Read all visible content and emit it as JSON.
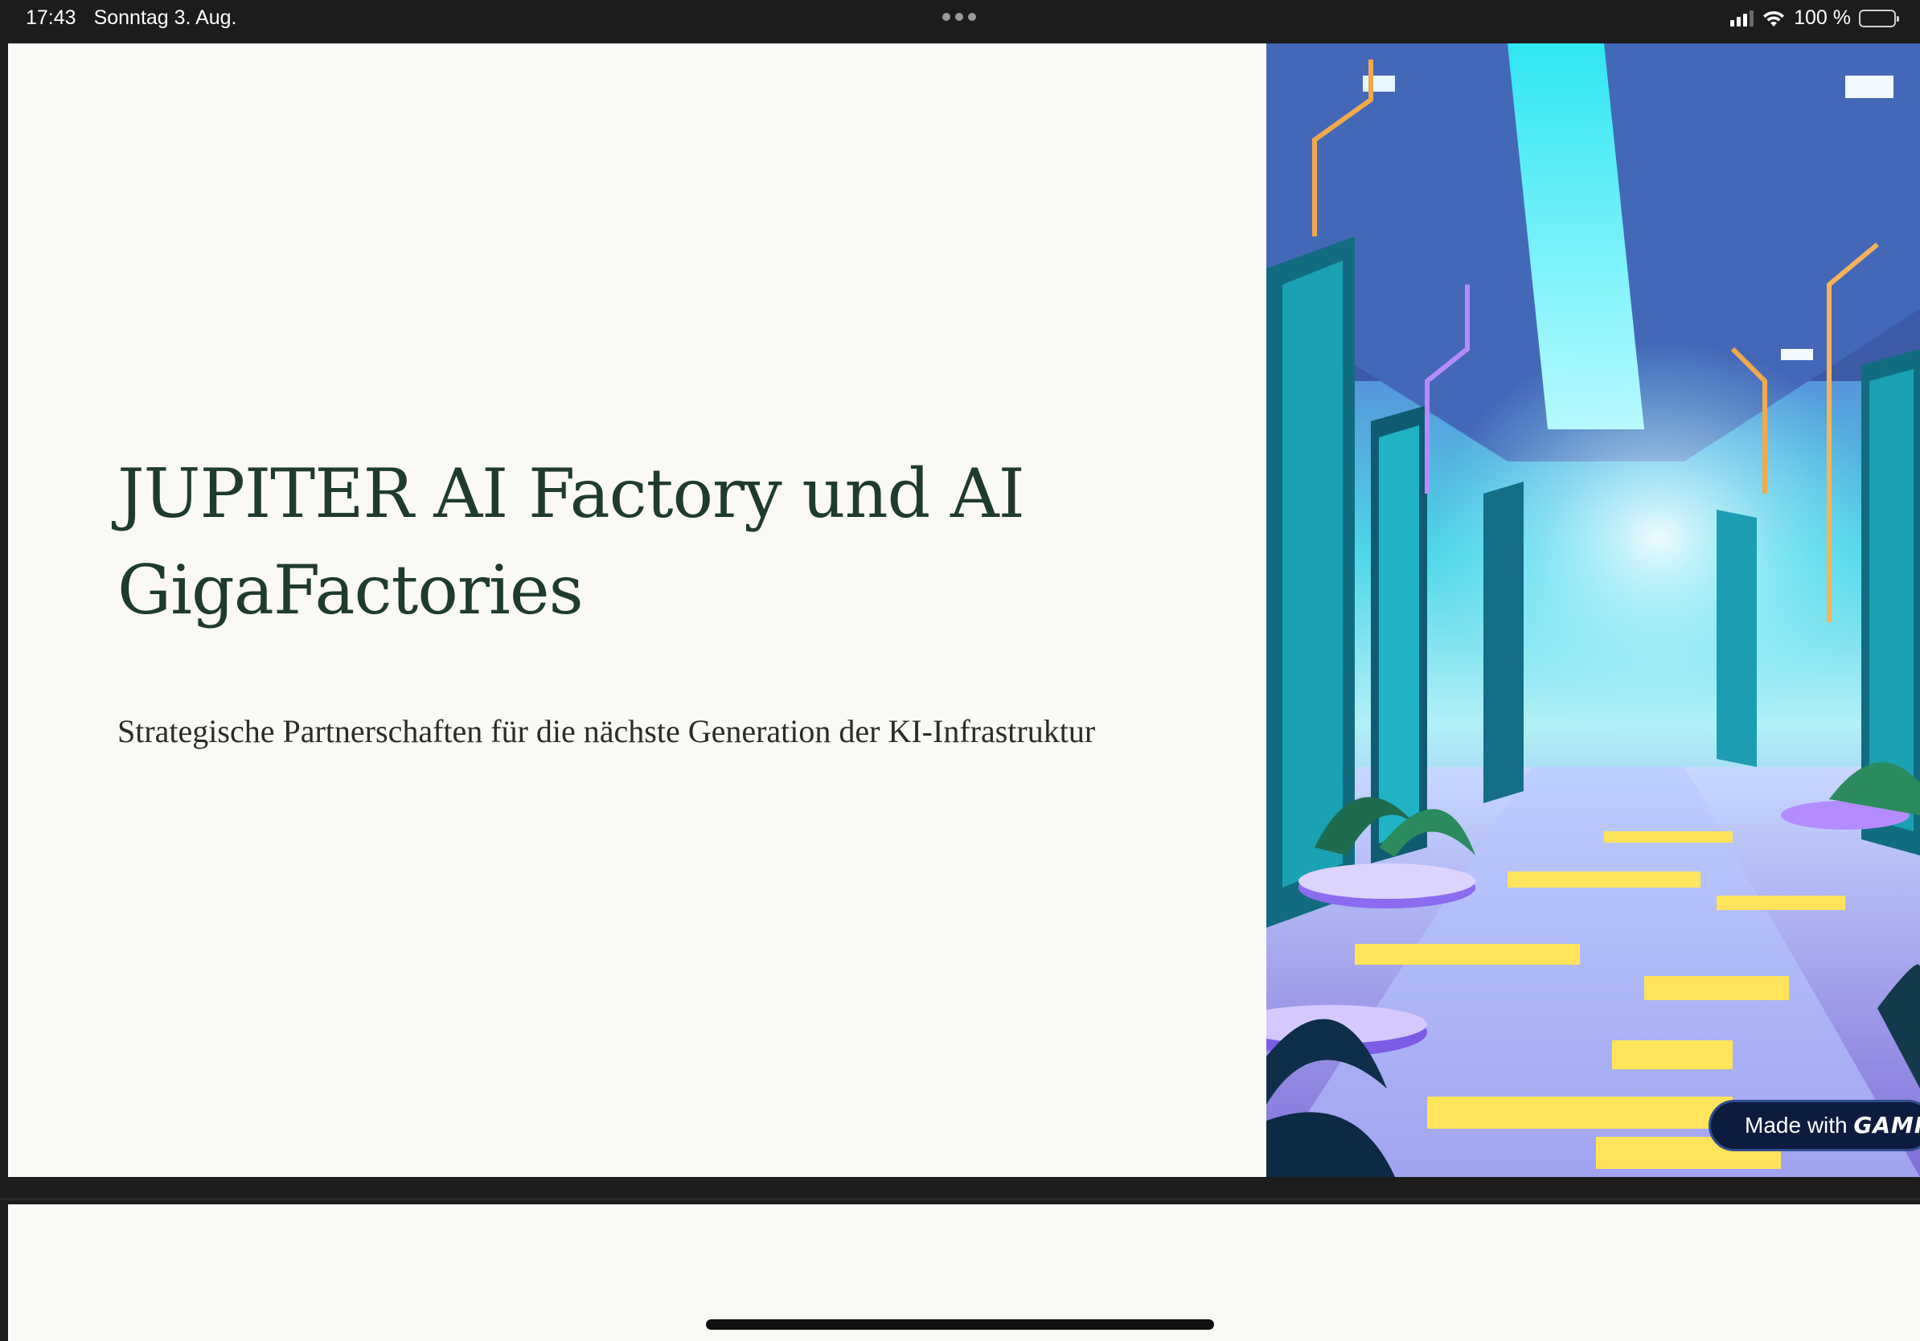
{
  "status_bar": {
    "time": "17:43",
    "date": "Sonntag 3. Aug.",
    "battery_text": "100 %",
    "signal_icon": "cellular-signal-icon",
    "wifi_icon": "wifi-icon",
    "battery_icon": "battery-icon",
    "multitask_icon": "multitasking-dots-icon"
  },
  "slide": {
    "title": "JUPITER AI Factory und AI GigaFactories",
    "subtitle": "Strategische Partnerschaften für die nächste Generation der KI-Infrastruktur",
    "title_color": "#1f3b30",
    "background": "#fbf9f5"
  },
  "badge": {
    "prefix": "Made with ",
    "brand": "GAMMA"
  },
  "colors": {
    "system_bar": "#1c1c1c",
    "accent_cyan": "#3fe6f0",
    "accent_yellow": "#ffe45c",
    "accent_purple": "#b48cff"
  }
}
